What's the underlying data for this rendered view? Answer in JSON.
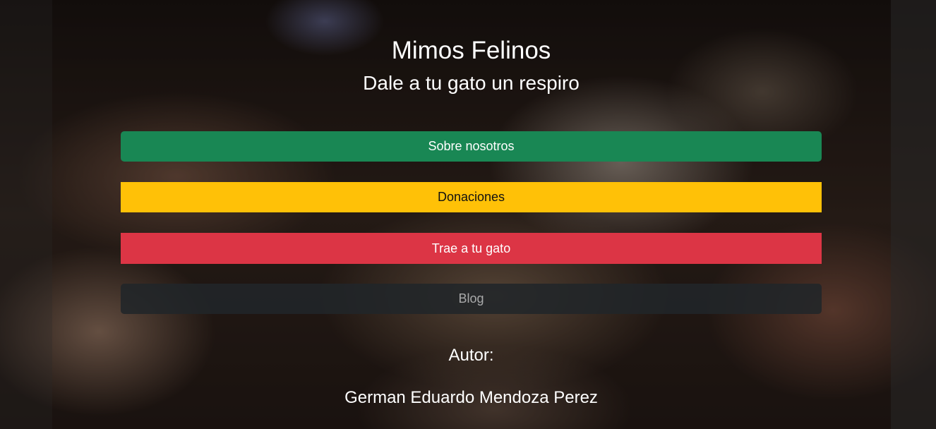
{
  "header": {
    "title": "Mimos Felinos",
    "subtitle": "Dale a tu gato un respiro"
  },
  "nav": {
    "buttons": [
      {
        "label": "Sobre nosotros",
        "color": "#198754"
      },
      {
        "label": "Donaciones",
        "color": "#ffc107"
      },
      {
        "label": "Trae a tu gato",
        "color": "#dc3545"
      },
      {
        "label": "Blog",
        "color": "#212529"
      }
    ]
  },
  "author": {
    "label": "Autor:",
    "name": "German Eduardo Mendoza Perez"
  }
}
